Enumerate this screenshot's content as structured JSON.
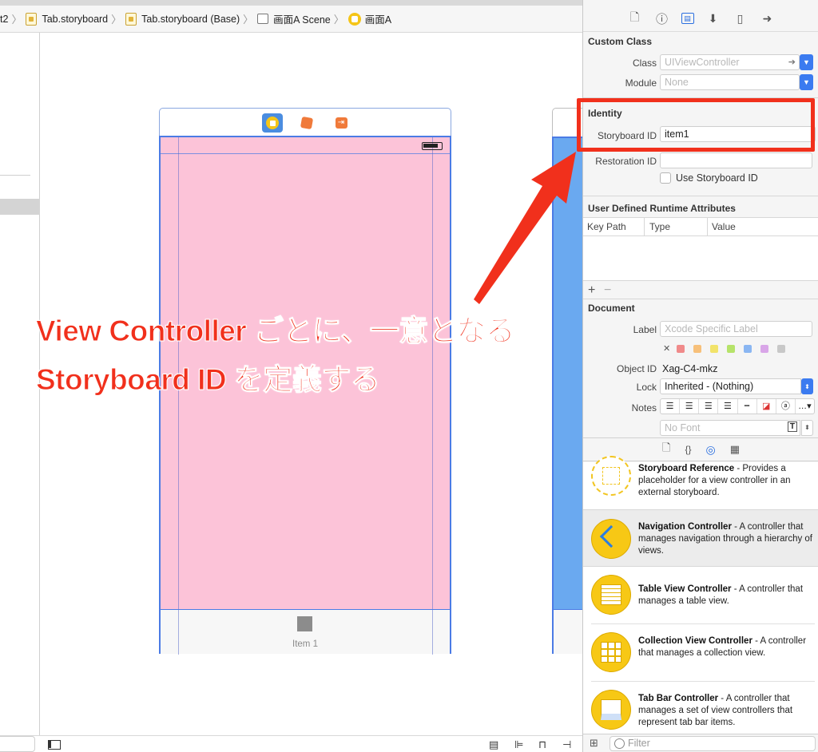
{
  "breadcrumb": {
    "items": [
      "t2",
      "Tab.storyboard",
      "Tab.storyboard (Base)",
      "画面A Scene",
      "画面A"
    ]
  },
  "scene": {
    "tab_item_label": "Item 1",
    "background_color": "#fcc3d8",
    "frame_color": "#4b7be5"
  },
  "inspector": {
    "custom_class": {
      "title": "Custom Class",
      "class_label": "Class",
      "class_placeholder": "UIViewController",
      "module_label": "Module",
      "module_placeholder": "None"
    },
    "identity": {
      "title": "Identity",
      "storyboard_id_label": "Storyboard ID",
      "storyboard_id_value": "item1",
      "restoration_id_label": "Restoration ID",
      "use_storyboard_id_label": "Use Storyboard ID"
    },
    "runtime_attrs": {
      "title": "User Defined Runtime Attributes",
      "columns": [
        "Key Path",
        "Type",
        "Value"
      ],
      "add": "+",
      "remove": "−"
    },
    "document": {
      "title": "Document",
      "label_label": "Label",
      "label_placeholder": "Xcode Specific Label",
      "object_id_label": "Object ID",
      "object_id_value": "Xag-C4-mkz",
      "lock_label": "Lock",
      "lock_value": "Inherited - (Nothing)",
      "notes_label": "Notes",
      "font_placeholder": "No Font",
      "label_colors": [
        "#f08a8a",
        "#f7c07a",
        "#f2e36a",
        "#b6e36a",
        "#8ab6f2",
        "#d9a6e8",
        "#c8c8c8"
      ]
    },
    "library": [
      {
        "title": "Storyboard Reference",
        "desc": " - Provides a placeholder for a view controller in an external storyboard."
      },
      {
        "title": "Navigation Controller",
        "desc": " - A controller that manages navigation through a hierarchy of views."
      },
      {
        "title": "Table View Controller",
        "desc": " - A controller that manages a table view."
      },
      {
        "title": "Collection View Controller",
        "desc": " - A controller that manages a collection view."
      },
      {
        "title": "Tab Bar Controller",
        "desc": " - A controller that manages a set of view controllers that represent tab bar items."
      }
    ],
    "filter_placeholder": "Filter"
  },
  "annotation": {
    "line1": "View Controller ごとに、一意となる",
    "line2": "Storyboard ID を定義する",
    "color": "#f1301c"
  }
}
